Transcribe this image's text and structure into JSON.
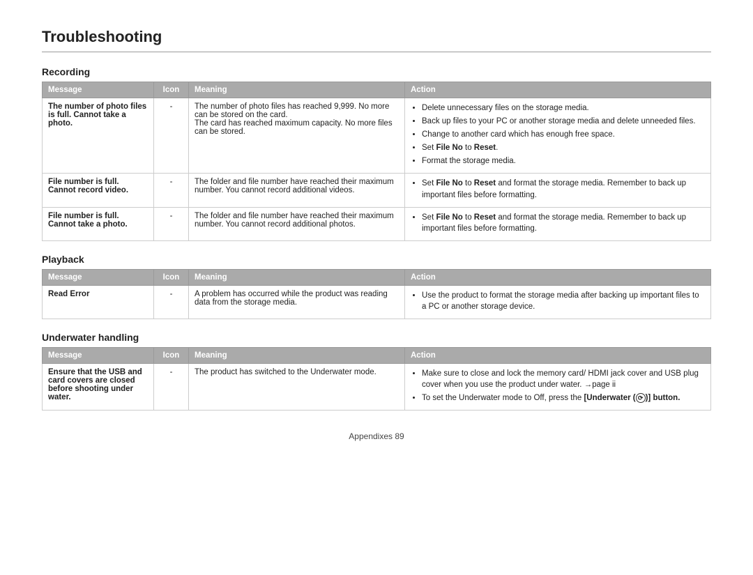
{
  "page": {
    "title": "Troubleshooting",
    "footer": "Appendixes  89"
  },
  "sections": [
    {
      "id": "recording",
      "heading": "Recording",
      "columns": [
        "Message",
        "Icon",
        "Meaning",
        "Action"
      ],
      "rows": [
        {
          "message": "The number of photo files is full. Cannot take a photo.",
          "message_bold": true,
          "icon": "-",
          "meaning": "The number of photo files has reached 9,999. No more can be stored on the card.\nThe card has reached maximum capacity. No more files can be stored.",
          "action_items": [
            "Delete unnecessary files on the storage media.",
            "Back up files to your PC or another storage media and delete unneeded files.",
            "Change to another card which has enough free space.",
            "Set File No to Reset.",
            "Format the storage media."
          ],
          "action_bold_words": [
            [
              "File No",
              "Reset"
            ]
          ]
        },
        {
          "message": "File number is full. Cannot record video.",
          "message_bold": true,
          "icon": "-",
          "meaning": "The folder and file number have reached their maximum number. You cannot record additional videos.",
          "action_items": [
            "Set File No to Reset and format the storage media. Remember to back up important files before formatting."
          ],
          "action_bold_words": [
            [
              "File No",
              "Reset"
            ]
          ]
        },
        {
          "message": "File number is full. Cannot take a photo.",
          "message_bold": true,
          "icon": "-",
          "meaning": "The folder and file number have reached their maximum number. You cannot record additional photos.",
          "action_items": [
            "Set File No to Reset and format the storage media. Remember to back up important files before formatting."
          ],
          "action_bold_words": [
            [
              "File No",
              "Reset"
            ]
          ]
        }
      ]
    },
    {
      "id": "playback",
      "heading": "Playback",
      "columns": [
        "Message",
        "Icon",
        "Meaning",
        "Action"
      ],
      "rows": [
        {
          "message": "Read Error",
          "message_bold": true,
          "icon": "-",
          "meaning": "A problem has occurred while the product was reading data from the storage media.",
          "action_items": [
            "Use the product to format the storage media after backing up important files to a PC or another storage device."
          ]
        }
      ]
    },
    {
      "id": "underwater",
      "heading": "Underwater handling",
      "columns": [
        "Message",
        "Icon",
        "Meaning",
        "Action"
      ],
      "rows": [
        {
          "message": "Ensure that the USB and card covers are closed before shooting under water.",
          "message_bold": true,
          "icon": "-",
          "meaning": "The product has switched to the Underwater mode.",
          "action_items": [
            "Make sure to close and lock the memory card/ HDMI jack cover and USB plug cover when you use the product under water. →page ii",
            "To set the Underwater mode to Off, press the [Underwater (icon)] button."
          ]
        }
      ]
    }
  ]
}
